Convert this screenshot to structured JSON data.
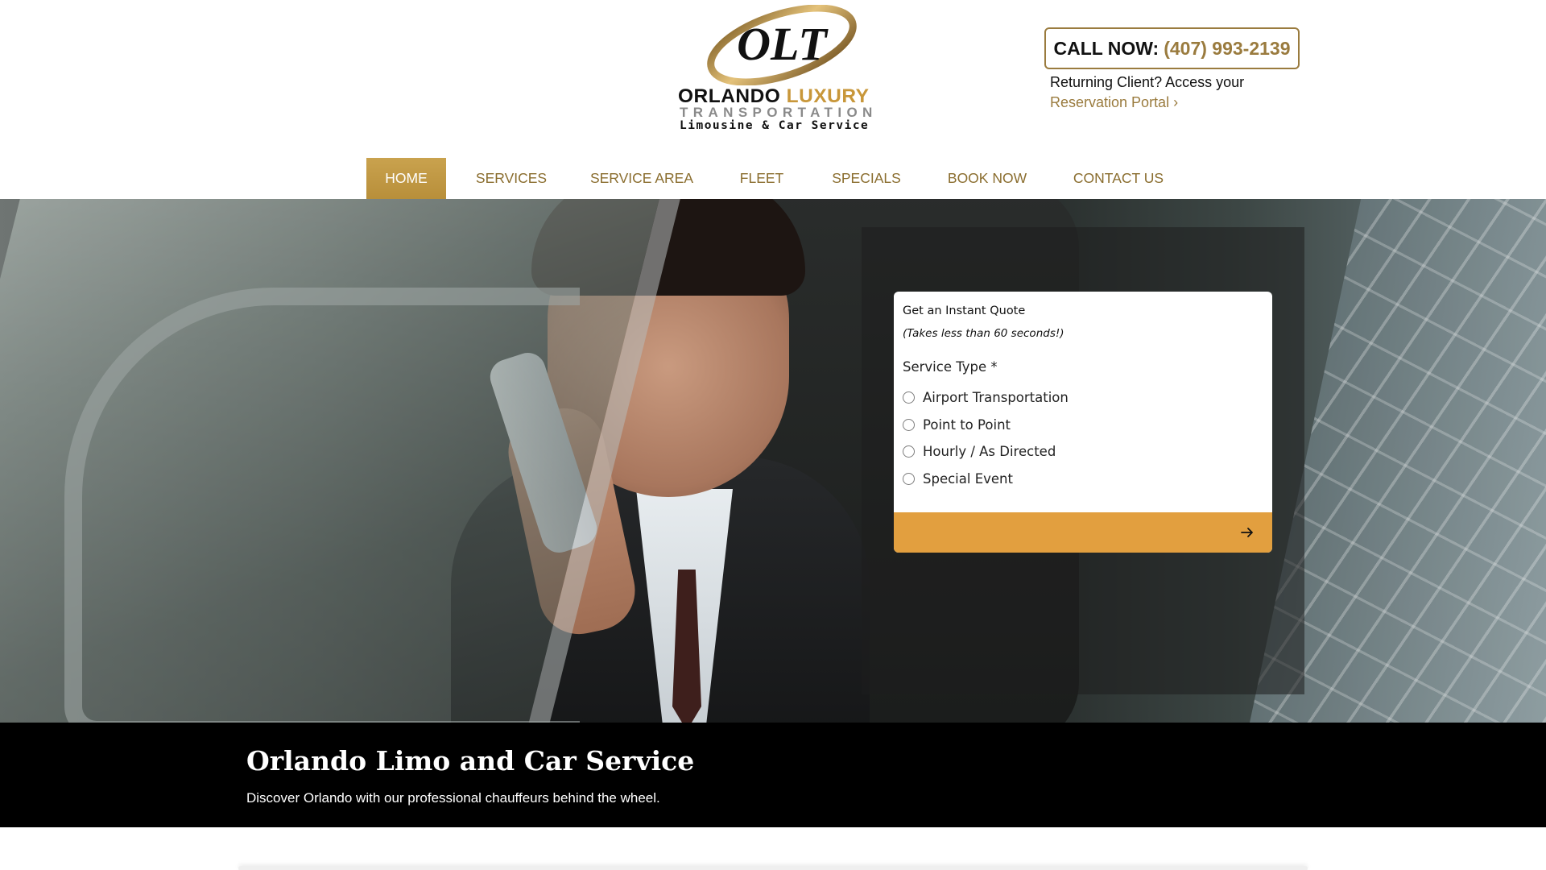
{
  "brand": {
    "logo_mark": "OLT",
    "line1_a": "ORLANDO",
    "line1_b": "LUXURY",
    "line2": "TRANSPORTATION",
    "line3": "Limousine & Car Service",
    "accent_color": "#9a7b3e"
  },
  "header": {
    "call_label": "CALL NOW:",
    "call_number": "(407) 993-2139",
    "returning_text": "Returning Client? Access your",
    "portal_link": "Reservation Portal ›"
  },
  "nav": {
    "items": [
      {
        "label": "HOME",
        "active": true
      },
      {
        "label": "SERVICES",
        "active": false
      },
      {
        "label": "SERVICE AREA",
        "active": false
      },
      {
        "label": "FLEET",
        "active": false
      },
      {
        "label": "SPECIALS",
        "active": false
      },
      {
        "label": "BOOK NOW",
        "active": false
      },
      {
        "label": "CONTACT US",
        "active": false
      }
    ]
  },
  "quote": {
    "title": "Get an Instant Quote",
    "subtitle": "(Takes less than 60 seconds!)",
    "service_label": "Service Type *",
    "options": [
      "Airport Transportation",
      "Point to Point",
      "Hourly / As Directed",
      "Special Event"
    ],
    "next_icon": "arrow-right-icon",
    "button_color": "#e29f3f"
  },
  "intro": {
    "title": "Orlando Limo and Car Service",
    "text": "Discover Orlando with our professional chauffeurs behind the wheel."
  }
}
